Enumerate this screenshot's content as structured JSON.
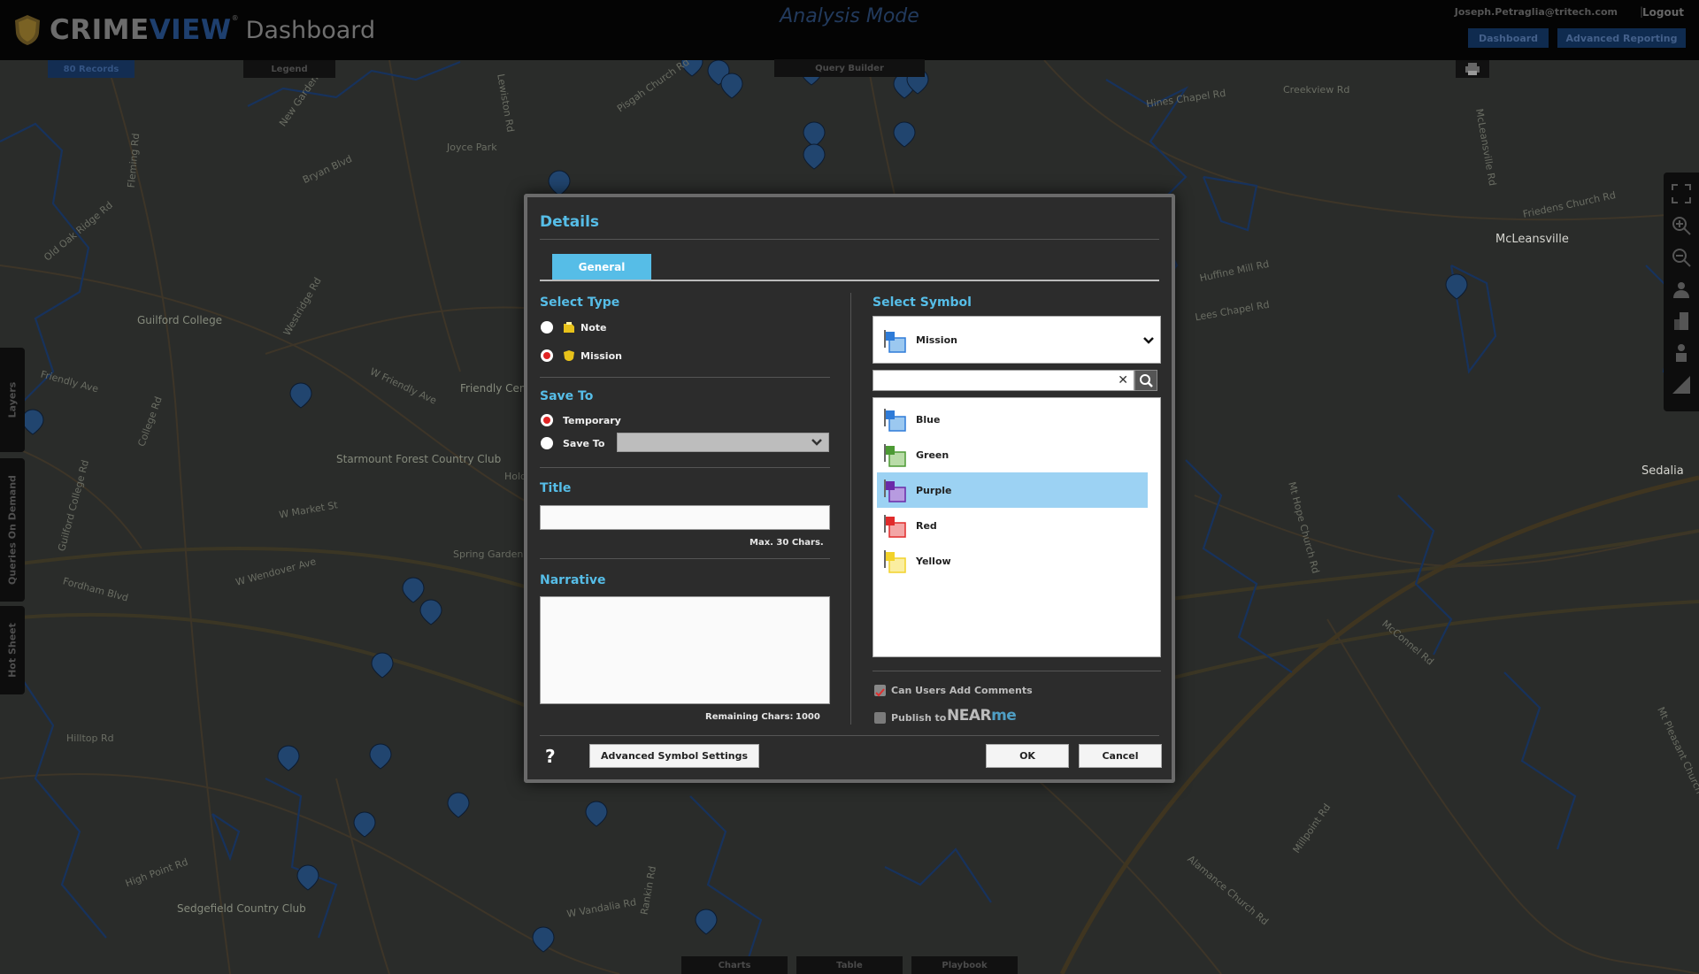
{
  "header": {
    "brand_crime": "CRIME",
    "brand_view": "VIEW",
    "brand_tm": "®",
    "brand_suffix": "Dashboard",
    "mode": "Analysis Mode",
    "user_email": "Joseph.Petraglia@tritech.com",
    "separator": "|",
    "logout": "Logout",
    "dashboard_btn": "Dashboard",
    "reporting_btn": "Advanced Reporting"
  },
  "subtabs": {
    "records": "80 Records",
    "legend": "Legend",
    "query_builder": "Query Builder",
    "charts": "Charts",
    "table": "Table",
    "playbook": "Playbook"
  },
  "side_tabs": [
    "Layers",
    "Queries On Demand",
    "Hot Sheet"
  ],
  "map_labels": [
    "New Garden Rd",
    "Joyce Park",
    "Lewiston Rd",
    "Pisgah Church Rd",
    "Hines Chapel Rd",
    "Creekview Rd",
    "McLeansville Rd",
    "Fleming Rd",
    "Bryan Blvd",
    "Old Oak Ridge Rd",
    "Guilford College",
    "Westridge Rd",
    "Friendly Ave",
    "W Friendly Ave",
    "Friendly Center",
    "Starmount Forest Country Club",
    "W Market St",
    "Guilford College Rd",
    "College Rd",
    "Holden Rd",
    "Spring Garden",
    "W Wendover Ave",
    "Fordham Blvd",
    "Hilltop Rd",
    "High Point Rd",
    "Sedgefield Country Club",
    "W Vandalia Rd",
    "Rankin Rd",
    "Huffine Mill Rd",
    "Lees Chapel Rd",
    "Mt Hope Church Rd",
    "McConnel Rd",
    "Millpoint Rd",
    "Alamance Church Rd",
    "Sedalia",
    "McLeansville",
    "Friedens Church Rd",
    "Mt Pleasant Church Rd"
  ],
  "dialog": {
    "title": "Details",
    "tab_general": "General",
    "select_type": "Select Type",
    "type_options": [
      {
        "label": "Note",
        "selected": false
      },
      {
        "label": "Mission",
        "selected": true
      }
    ],
    "save_to_heading": "Save To",
    "save_options": [
      {
        "label": "Temporary",
        "selected": true
      },
      {
        "label": "Save To",
        "selected": false
      }
    ],
    "save_to_select_value": "",
    "title_heading": "Title",
    "title_value": "",
    "title_hint": "Max. 30 Chars.",
    "narrative_heading": "Narrative",
    "narrative_value": "",
    "remaining_label": "Remaining Chars:",
    "remaining_value": "1000",
    "select_symbol": "Select Symbol",
    "symbol_selected": "Mission",
    "symbol_search_value": "",
    "symbol_search_clear": "✕",
    "symbols": [
      {
        "label": "Blue",
        "color": "#2e7bd8",
        "selected": false
      },
      {
        "label": "Green",
        "color": "#4c9a34",
        "selected": false
      },
      {
        "label": "Purple",
        "color": "#6a2aa8",
        "selected": true
      },
      {
        "label": "Red",
        "color": "#e02b2b",
        "selected": false
      },
      {
        "label": "Yellow",
        "color": "#f2d22a",
        "selected": false
      }
    ],
    "allow_comments_label": "Can Users Add Comments",
    "allow_comments_checked": true,
    "publish_label": "Publish to",
    "publish_checked": false,
    "nearme_near": "NEAR",
    "nearme_me": "me",
    "help": "?",
    "advanced_btn": "Advanced Symbol Settings",
    "ok_btn": "OK",
    "cancel_btn": "Cancel"
  },
  "colors": {
    "accent": "#56bde7",
    "selected_row": "#9cd2f3",
    "radio_on": "#e02424",
    "map_bg": "#2a2c2a"
  }
}
